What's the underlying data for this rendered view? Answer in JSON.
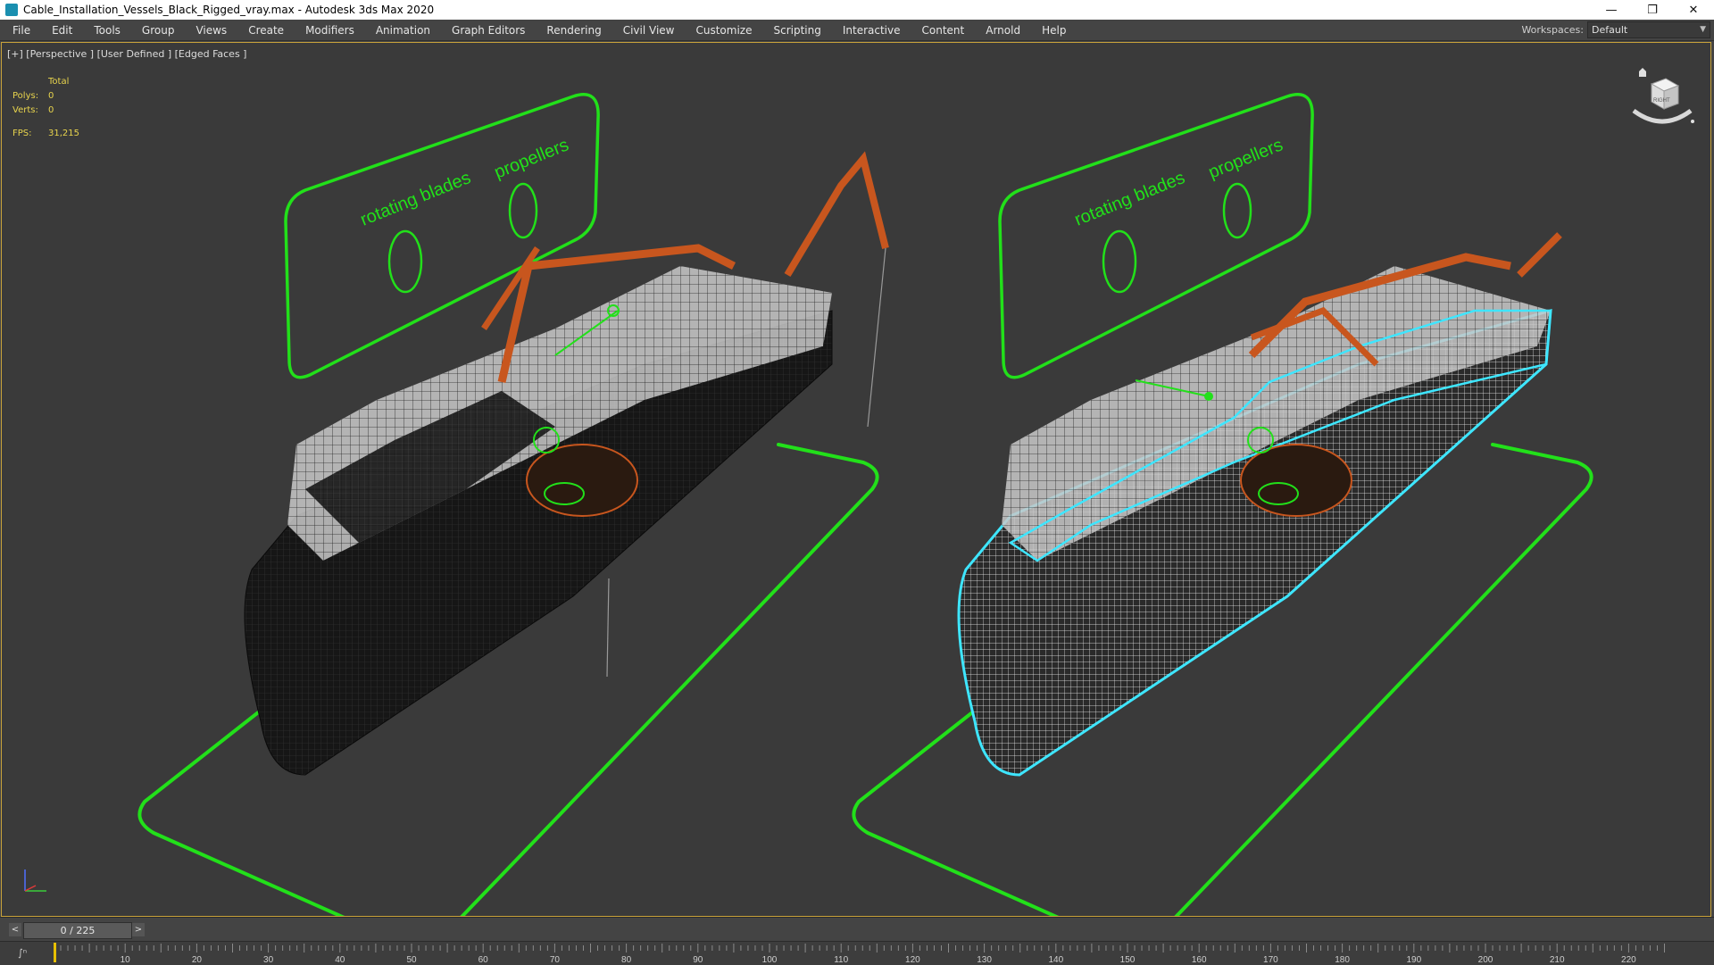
{
  "window": {
    "title": "Cable_Installation_Vessels_Black_Rigged_vray.max - Autodesk 3ds Max 2020",
    "controls": [
      "minimize-icon",
      "restore-icon",
      "close-icon"
    ]
  },
  "menu": [
    "File",
    "Edit",
    "Tools",
    "Group",
    "Views",
    "Create",
    "Modifiers",
    "Animation",
    "Graph Editors",
    "Rendering",
    "Civil View",
    "Customize",
    "Scripting",
    "Interactive",
    "Content",
    "Arnold",
    "Help"
  ],
  "workspace": {
    "label": "Workspaces:",
    "value": "Default"
  },
  "viewport": {
    "label": "[+] [Perspective ] [User Defined ] [Edged Faces ]",
    "stats": {
      "total_label": "Total",
      "polys_label": "Polys:",
      "polys": "0",
      "verts_label": "Verts:",
      "verts": "0",
      "fps_label": "FPS:",
      "fps": "31,215"
    },
    "annotations": {
      "left_rotating": "rotating blades",
      "left_propellers": "propellers",
      "right_rotating": "rotating blades",
      "right_propellers": "propellers"
    },
    "viewcube_label": "RIGHT",
    "colors": {
      "accent_green": "#22e01a",
      "selection_cyan": "#3ee6ff",
      "crane_orange": "#c8561e",
      "frame_gold": "#c8a23a"
    }
  },
  "timeline": {
    "frame": "0 / 225",
    "prev": "<",
    "next": ">",
    "ticks": [
      "10",
      "20",
      "30",
      "40",
      "50",
      "60",
      "70",
      "80",
      "90",
      "100",
      "110",
      "120",
      "130",
      "140",
      "150",
      "160",
      "170",
      "180",
      "190",
      "200",
      "210",
      "220"
    ]
  }
}
